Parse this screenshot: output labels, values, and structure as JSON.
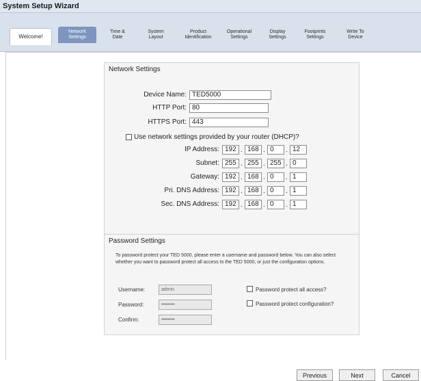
{
  "window": {
    "title": "System Setup Wizard"
  },
  "tabs": [
    {
      "label": "Welcome!"
    },
    {
      "label": "Network\nSettings"
    },
    {
      "label": "Time &\nDate"
    },
    {
      "label": "System\nLayout"
    },
    {
      "label": "Product\nIdentification"
    },
    {
      "label": "Operational\nSettings"
    },
    {
      "label": "Display\nSettings"
    },
    {
      "label": "Footprints\nSettings"
    },
    {
      "label": "Write To\nDevice"
    }
  ],
  "network": {
    "legend": "Network Settings",
    "device_name_label": "Device Name:",
    "device_name_value": "TED5000",
    "http_port_label": "HTTP Port:",
    "http_port_value": "80",
    "https_port_label": "HTTPS Port:",
    "https_port_value": "443",
    "dhcp_label": "Use network settings provided by your router (DHCP)?",
    "ip_label": "IP Address:",
    "ip": [
      "192",
      "168",
      "0",
      "12"
    ],
    "subnet_label": "Subnet:",
    "subnet": [
      "255",
      "255",
      "255",
      "0"
    ],
    "gateway_label": "Gateway:",
    "gateway": [
      "192",
      "168",
      "0",
      "1"
    ],
    "pri_dns_label": "Pri. DNS Address:",
    "pri_dns": [
      "192",
      "168",
      "0",
      "1"
    ],
    "sec_dns_label": "Sec. DNS Address:",
    "sec_dns": [
      "192",
      "168",
      "0",
      "1"
    ],
    "separator": "."
  },
  "password": {
    "legend": "Password Settings",
    "description": "To password protect your TED 5000, please enter a username and password below. You can also select whether you want to password protect all access to the TED 5000, or just the configuration options.",
    "username_label": "Username:",
    "username_value": "admin",
    "password_label": "Password:",
    "password_value": "••••••••",
    "confirm_label": "Confirm:",
    "confirm_value": "••••••••",
    "protect_all_label": "Password protect all access?",
    "protect_config_label": "Password protect configuration?"
  },
  "footer": {
    "previous": "Previous",
    "next": "Next",
    "cancel": "Cancel"
  },
  "colors": {
    "active_tab": "#7d95bf",
    "tab_bar": "#d9e1ec",
    "title_bar": "#dfe7f1"
  }
}
